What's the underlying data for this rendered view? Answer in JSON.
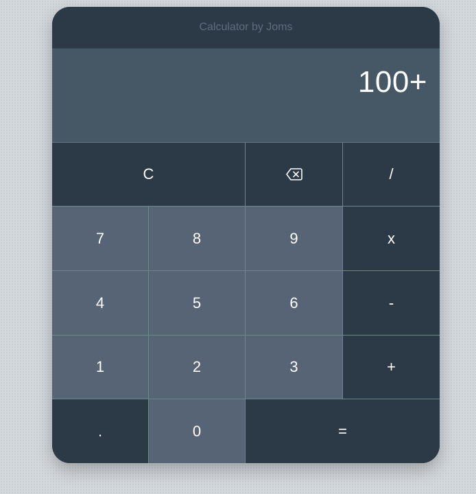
{
  "app": {
    "title": "Calculator by Joms"
  },
  "display": {
    "value": "100+"
  },
  "keys": {
    "clear": "C",
    "backspace_icon": "backspace-icon",
    "divide": "/",
    "seven": "7",
    "eight": "8",
    "nine": "9",
    "multiply": "x",
    "four": "4",
    "five": "5",
    "six": "6",
    "subtract": "-",
    "one": "1",
    "two": "2",
    "three": "3",
    "add": "+",
    "decimal": ".",
    "zero": "0",
    "equals": "="
  },
  "colors": {
    "dark_key": "#2c3a47",
    "light_key": "#566476",
    "display_bg": "#465765",
    "title_text": "#5d6d7e",
    "grid_line": "#6a8a86"
  }
}
